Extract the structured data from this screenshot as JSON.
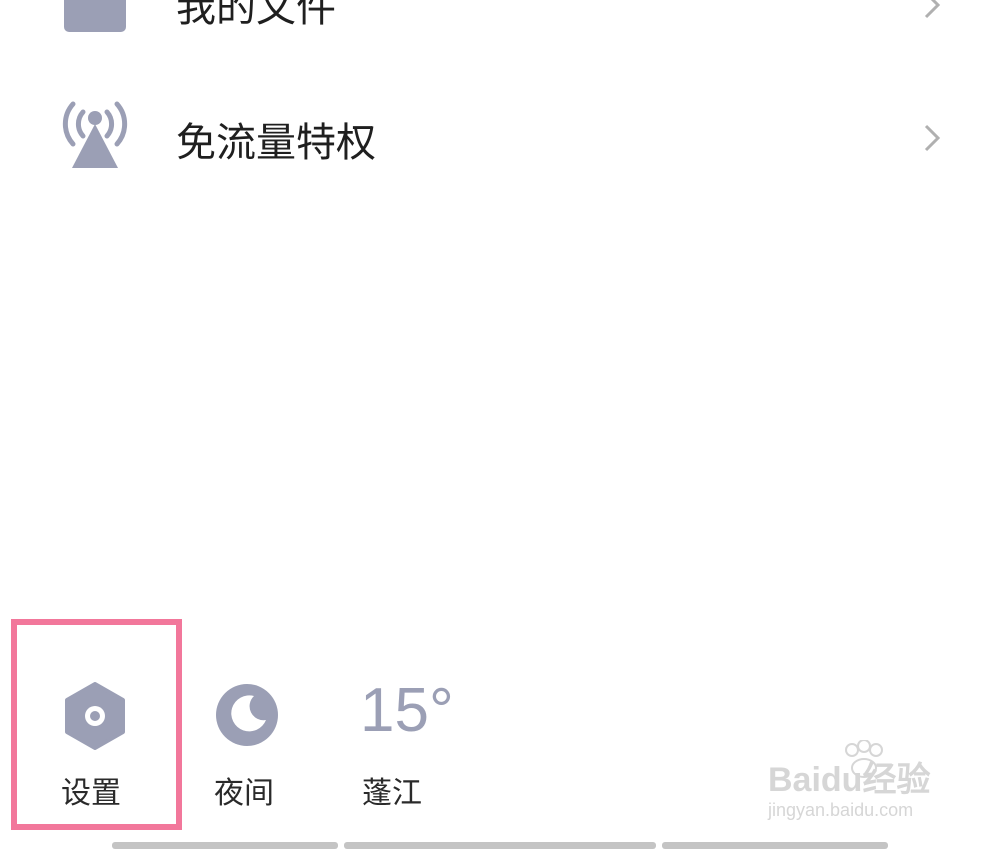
{
  "menu": {
    "items": [
      {
        "label": "我的文件",
        "icon": "folder-icon"
      },
      {
        "label": "免流量特权",
        "icon": "signal-tower-icon"
      }
    ]
  },
  "bottom_bar": {
    "settings_label": "设置",
    "night_label": "夜间",
    "weather": {
      "temperature": "15°",
      "city": "蓬江"
    }
  },
  "watermark": {
    "brand": "Baidu经验",
    "url": "jingyan.baidu.com"
  },
  "colors": {
    "icon_gray": "#9b9fb5",
    "highlight": "#f2779b",
    "text": "#1f1f1f"
  }
}
